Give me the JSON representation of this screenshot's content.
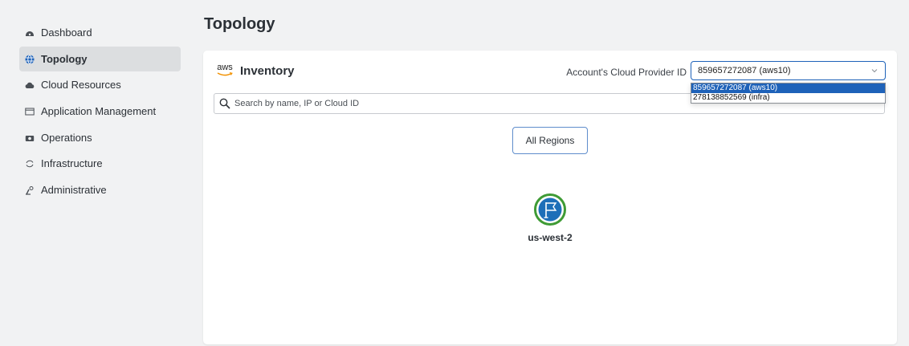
{
  "sidebar": {
    "items": [
      {
        "label": "Dashboard",
        "icon": "dashboard-icon"
      },
      {
        "label": "Topology",
        "icon": "globe-icon",
        "active": true
      },
      {
        "label": "Cloud Resources",
        "icon": "cloud-icon"
      },
      {
        "label": "Application Management",
        "icon": "app-window-icon"
      },
      {
        "label": "Operations",
        "icon": "camera-icon"
      },
      {
        "label": "Infrastructure",
        "icon": "refresh-icon"
      },
      {
        "label": "Administrative",
        "icon": "admin-icon"
      }
    ]
  },
  "page": {
    "title": "Topology"
  },
  "inventory": {
    "logo_text": "aws",
    "title": "Inventory",
    "provider_label": "Account's Cloud Provider ID",
    "selected_account": "859657272087 (aws10)",
    "account_options": [
      "859657272087 (aws10)",
      "278138852569 (infra)"
    ],
    "search_placeholder": "Search by name, IP or Cloud ID",
    "regions_button": "All Regions",
    "region": {
      "label": "us-west-2",
      "icon": "flag-icon"
    }
  },
  "colors": {
    "accent": "#1e62b9",
    "region_ring": "#3f9b35",
    "region_fill": "#1d6fb8",
    "nav_active_bg": "#dcdee0",
    "aws_smile": "#f29100"
  }
}
